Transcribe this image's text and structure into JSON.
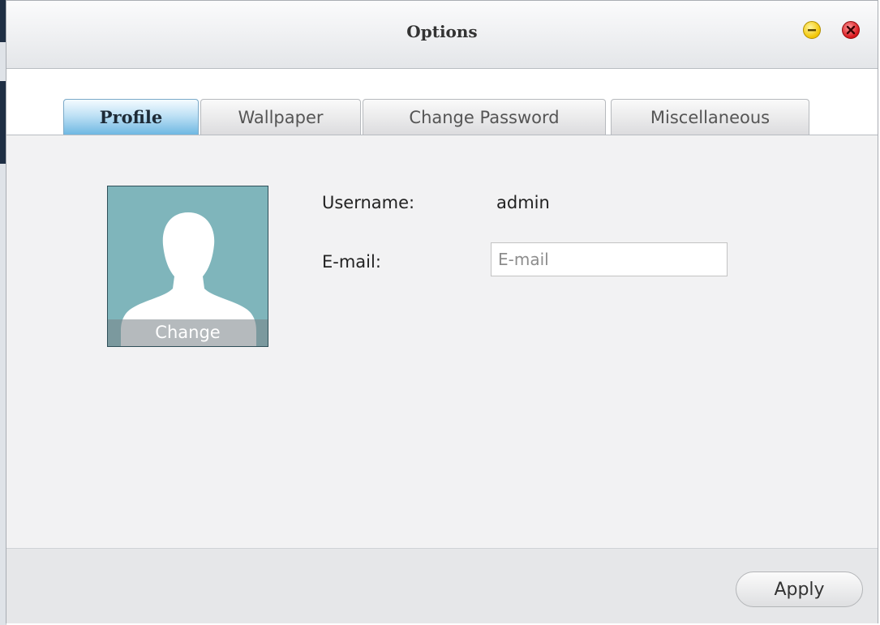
{
  "window": {
    "title": "Options",
    "minimize_icon": "minimize-icon",
    "close_icon": "close-icon"
  },
  "tabs": [
    {
      "label": "Profile",
      "active": true
    },
    {
      "label": "Wallpaper",
      "active": false
    },
    {
      "label": "Change Password",
      "active": false
    },
    {
      "label": "Miscellaneous",
      "active": false
    }
  ],
  "profile": {
    "avatar_icon": "user-silhouette-icon",
    "avatar_change_label": "Change",
    "username_label": "Username:",
    "username_value": "admin",
    "email_label": "E-mail:",
    "email_value": "",
    "email_placeholder": "E-mail"
  },
  "footer": {
    "apply_label": "Apply"
  },
  "colors": {
    "active_tab": "#6fb8e2",
    "avatar_bg": "#7fb5bb",
    "minimize": "#f2c400",
    "close": "#d7141a"
  }
}
